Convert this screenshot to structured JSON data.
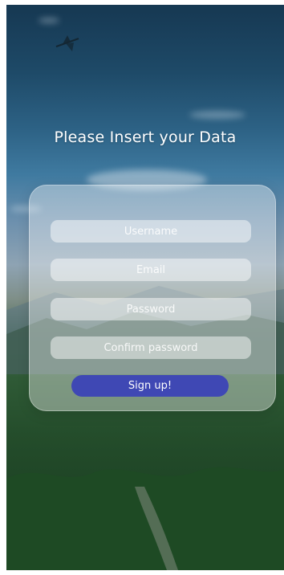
{
  "form": {
    "title": "Please Insert your Data",
    "fields": {
      "username_placeholder": "Username",
      "email_placeholder": "Email",
      "password_placeholder": "Password",
      "confirm_password_placeholder": "Confirm password"
    },
    "submit_label": "Sign up!"
  },
  "theme": {
    "accent": "#3f48b4",
    "title_color": "#ffffff"
  },
  "icons": {
    "background": "landscape-photo",
    "bird": "dragonfly-icon"
  }
}
